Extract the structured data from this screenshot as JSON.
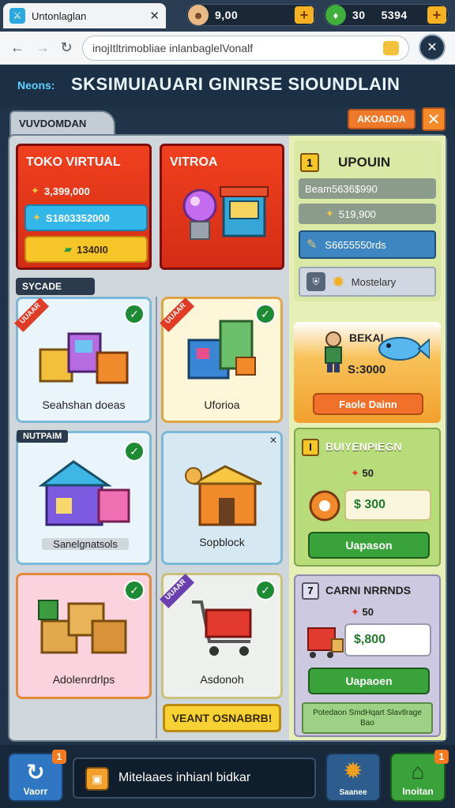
{
  "browser": {
    "tab_title": "Untonlaglan",
    "tab_close": "✕",
    "url": "inojItltrimobliae inlanbaglelVonalf"
  },
  "resources": {
    "coins": "9,00",
    "gems": "30",
    "score": "5394"
  },
  "header": {
    "label": "Neons:",
    "title": "SKSIMUIAUARI GINIRSE SIOUNDLAIN"
  },
  "panel": {
    "tab_label": "VUVDOMDAN",
    "top_button": "AKOADDA",
    "close": "✕"
  },
  "toko": {
    "title": "TOKO VIRTUAL",
    "price": "3,399,000",
    "blue_value": "S1803352000",
    "yellow_value": "1340I0"
  },
  "vitroa": {
    "title": "VITROA"
  },
  "section_label": "SYCADE",
  "shops": [
    {
      "name": "Seahshan doeas",
      "ribbon": "UUAAR"
    },
    {
      "name": "Uforioa",
      "ribbon": "UUAAR"
    },
    {
      "name": "Sanelgnatsols",
      "ribbon": "NUTPAIM"
    },
    {
      "name": "Sopblock",
      "ribbon": ""
    },
    {
      "name": "Adolenrdrlps",
      "ribbon": ""
    },
    {
      "name": "Asdonoh",
      "ribbon": "UUAAR"
    }
  ],
  "yellow_cta": "VEANT OSNABRB!",
  "upgrade": {
    "index": "1",
    "title": "UPOUIN",
    "row1": "Beam5636$990",
    "row2": "519,900",
    "row3": "S6655550rds",
    "row4": "Mostelary"
  },
  "promo": {
    "title": "BEKAI",
    "price": "S:3000",
    "button": "Faole Dainn"
  },
  "offer1": {
    "index": "I",
    "title": "BUIYENPIEGN",
    "price_small": "50",
    "price": "$ 300",
    "button": "Uapason"
  },
  "offer2": {
    "index": "7",
    "title": "CARNI NRRNDS",
    "price_small": "50",
    "price": "$,800",
    "button": "Uapaoen",
    "note": "Potedaon SmdHqart Slavtlrage Bao"
  },
  "bottom": {
    "left_label": "Vaorr",
    "left_badge": "1",
    "message": "Mitelaaes inhianl bidkar",
    "btn2_label": "Saanee",
    "btn3_label": "Inoitan",
    "btn3_badge": "1"
  }
}
